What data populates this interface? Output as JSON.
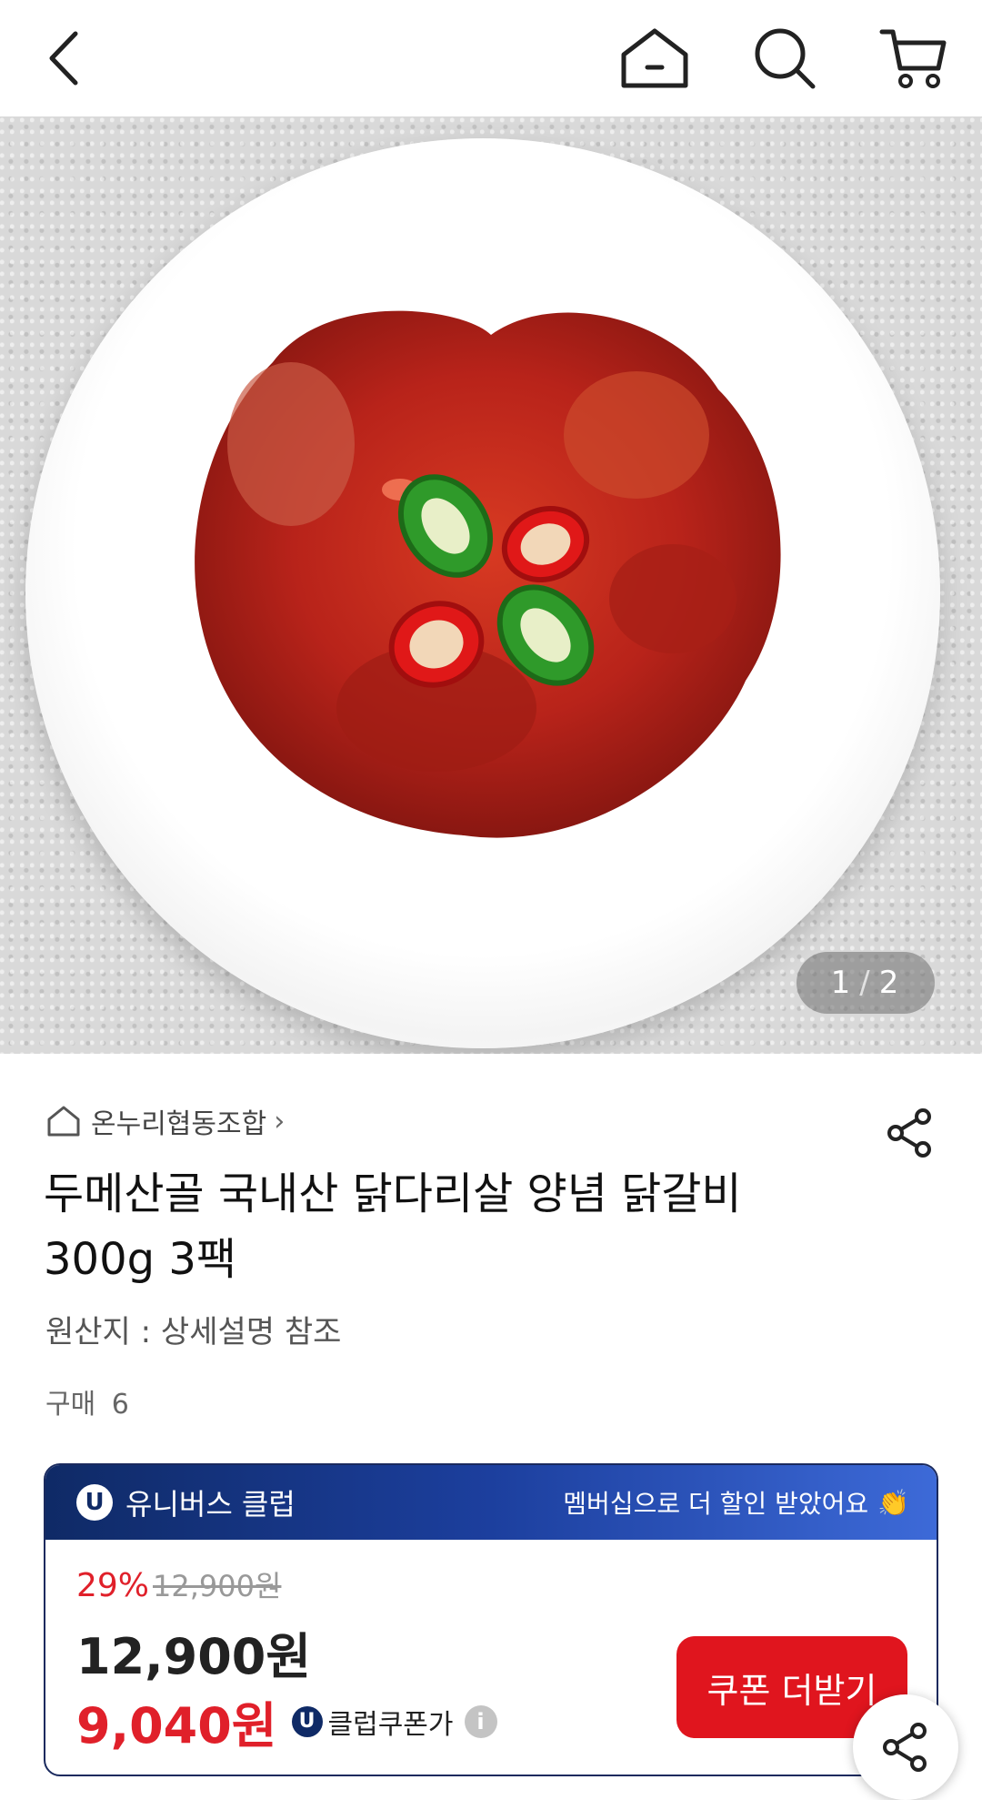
{
  "header": {
    "icons": [
      "back-icon",
      "home-icon",
      "search-icon",
      "cart-icon"
    ]
  },
  "gallery": {
    "current": "1",
    "separator": "/",
    "total": "2"
  },
  "product": {
    "seller": "온누리협동조합",
    "title": "두메산골 국내산 닭다리살 양념 닭갈비 300g 3팩",
    "origin": "원산지 : 상세설명 참조",
    "purchase_label": "구매",
    "purchase_count": "6"
  },
  "club": {
    "badge": "U",
    "name": "유니버스 클럽",
    "message": "멤버십으로 더 할인 받았어요",
    "clap": "👏",
    "discount": "29%",
    "original_price": "12,900원",
    "price": "12,900원",
    "coupon_price": "9,040원",
    "coupon_label": "클럽쿠폰가",
    "info_icon": "i",
    "coupon_button": "쿠폰 더받기"
  },
  "colors": {
    "accent_red": "#e0151e",
    "club_navy": "#0f2a66",
    "club_blue": "#3d6ad8"
  }
}
